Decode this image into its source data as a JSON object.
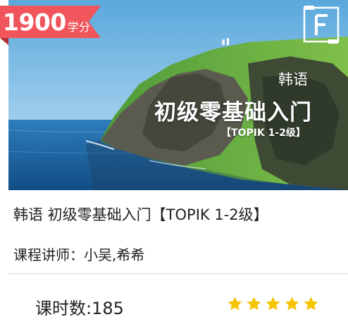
{
  "price": {
    "amount": "1900",
    "unit": "学分"
  },
  "cover": {
    "logo_icon": "f-logo-icon",
    "subtitle": "韩语",
    "title": "初级零基础入门",
    "tag": "【TOPIK 1-2级】"
  },
  "course": {
    "title": "韩语 初级零基础入门【TOPIK 1-2级】",
    "teacher": "课程讲师：小吴,希希",
    "hours": "课时数:185",
    "rating": 5
  },
  "colors": {
    "price_tag": "#f0555b",
    "star": "#f5c400",
    "divider": "#dddddd"
  }
}
